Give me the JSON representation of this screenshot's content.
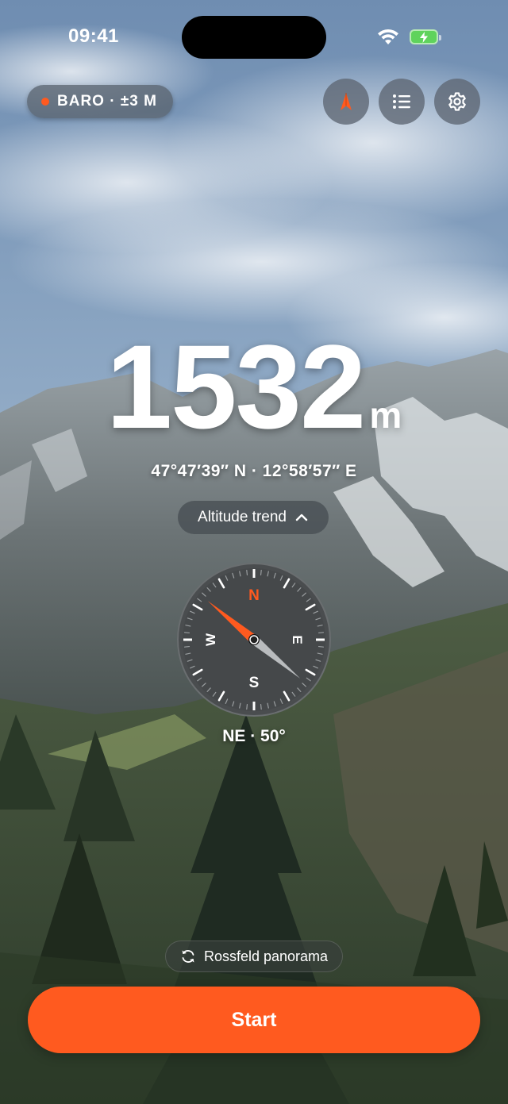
{
  "status_bar": {
    "time": "09:41"
  },
  "top_bar": {
    "sensor_badge": "BARO · ±3 M",
    "buttons": [
      {
        "name": "compass-arrow-button",
        "icon": "navigation-arrow-icon"
      },
      {
        "name": "list-button",
        "icon": "list-icon"
      },
      {
        "name": "settings-button",
        "icon": "gear-icon"
      }
    ]
  },
  "readout": {
    "altitude": "1532",
    "unit": "m",
    "coordinates": "47°47′39″ N · 12°58′57″ E",
    "trend_label": "Altitude trend"
  },
  "compass": {
    "north": "N",
    "east": "E",
    "south": "S",
    "west": "W",
    "heading_degrees": 50,
    "heading_text": "NE · 50°"
  },
  "location": {
    "label": "Rossfeld panorama"
  },
  "actions": {
    "start_label": "Start"
  },
  "colors": {
    "accent": "#ff5a1f",
    "pill_background": "#5a6470"
  }
}
